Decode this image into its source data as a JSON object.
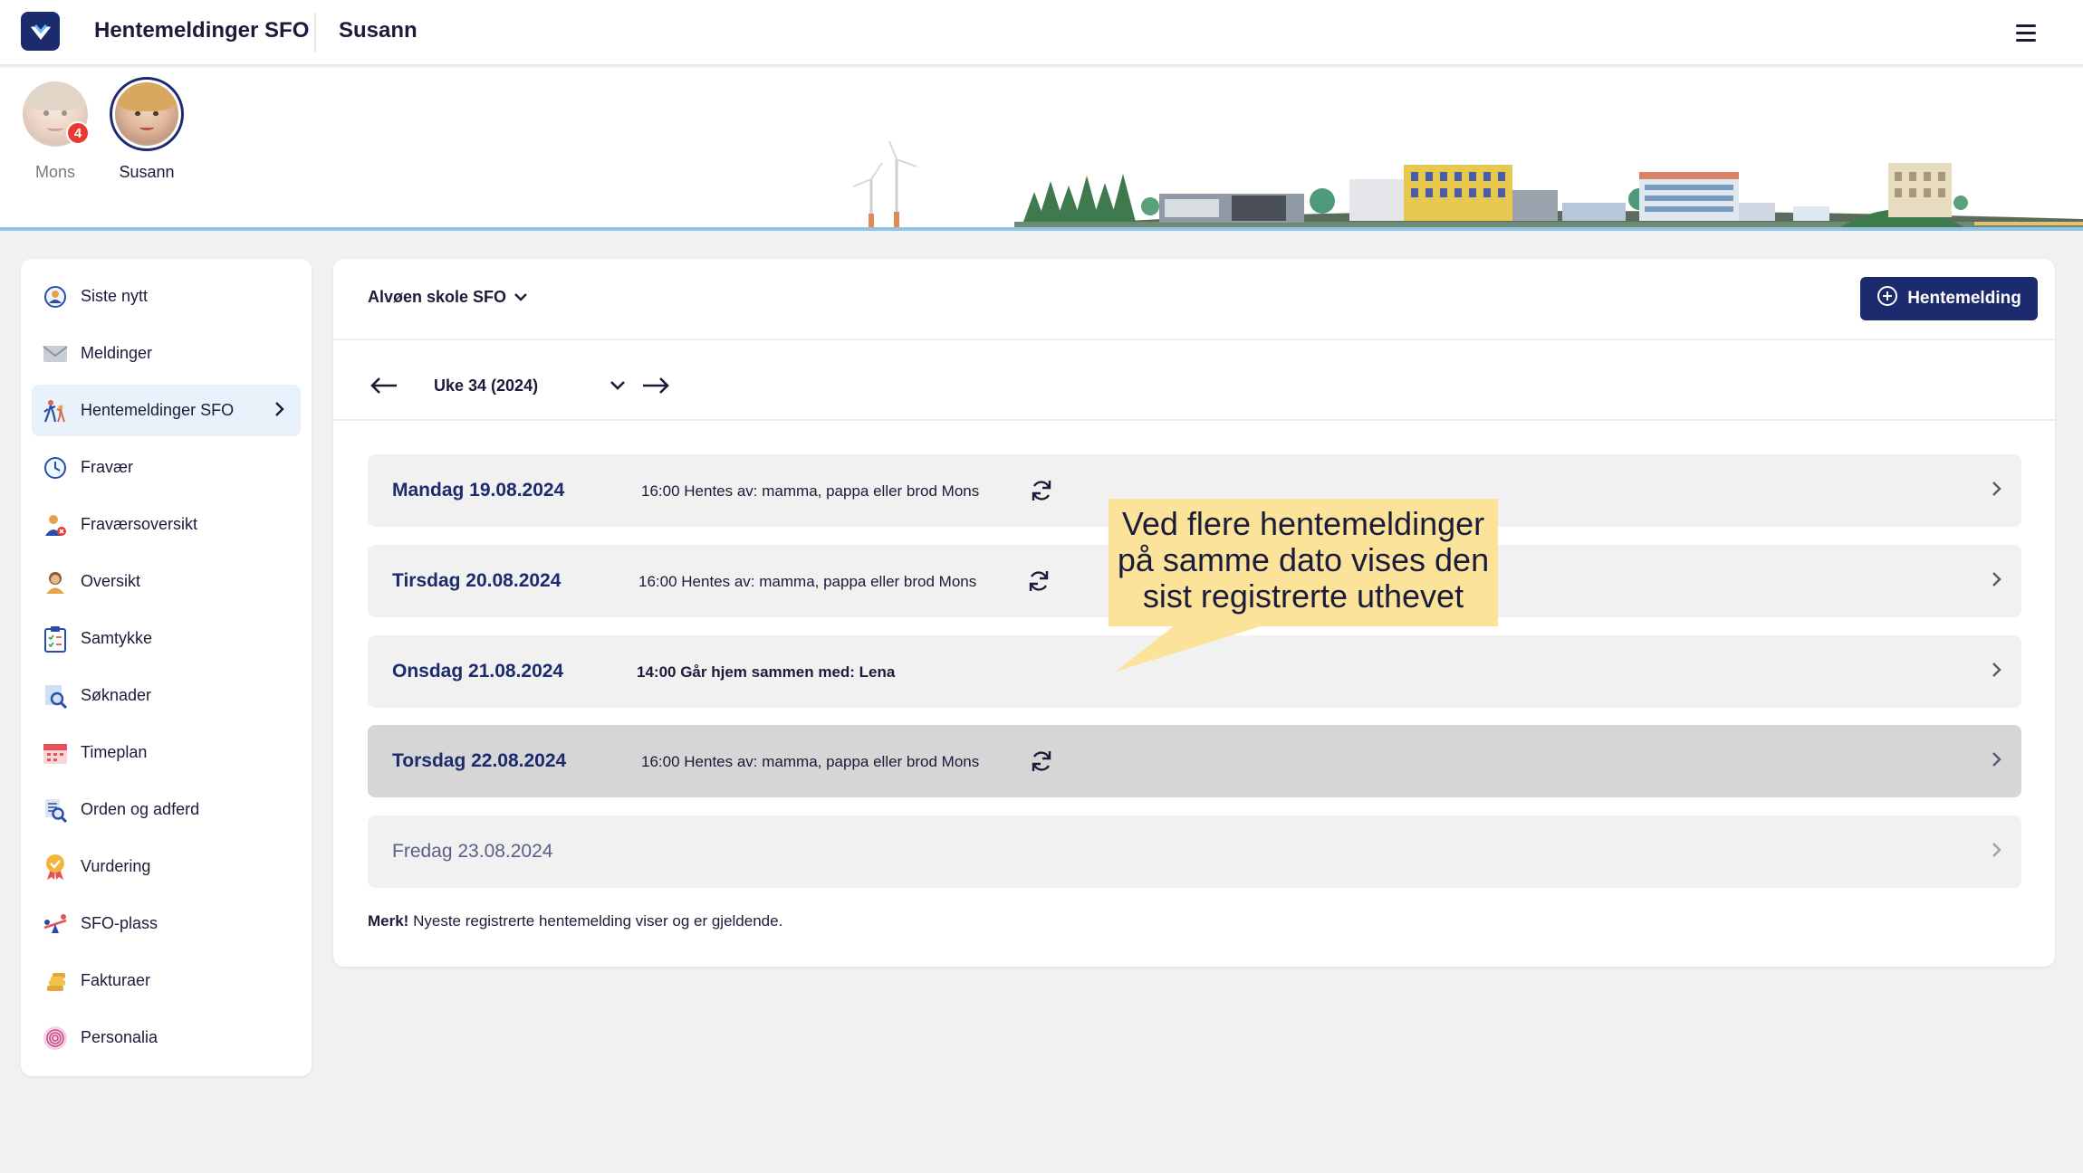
{
  "topbar": {
    "app_title": "Hentemeldinger SFO",
    "user_title": "Susann",
    "menu_icon": "hamburger-icon"
  },
  "children": [
    {
      "name": "Mons",
      "badge": "4",
      "active": false
    },
    {
      "name": "Susann",
      "badge": "",
      "active": true
    }
  ],
  "sidebar": {
    "items": [
      {
        "label": "Siste nytt",
        "icon": "news-icon"
      },
      {
        "label": "Meldinger",
        "icon": "envelope-icon"
      },
      {
        "label": "Hentemeldinger SFO",
        "icon": "pickup-icon",
        "active": true
      },
      {
        "label": "Fravær",
        "icon": "clock-icon"
      },
      {
        "label": "Fraværsoversikt",
        "icon": "absence-person-icon"
      },
      {
        "label": "Oversikt",
        "icon": "person-icon"
      },
      {
        "label": "Samtykke",
        "icon": "clipboard-icon"
      },
      {
        "label": "Søknader",
        "icon": "search-document-icon"
      },
      {
        "label": "Timeplan",
        "icon": "calendar-icon"
      },
      {
        "label": "Orden og adferd",
        "icon": "magnifier-document-icon"
      },
      {
        "label": "Vurdering",
        "icon": "medal-icon"
      },
      {
        "label": "SFO-plass",
        "icon": "seesaw-icon"
      },
      {
        "label": "Fakturaer",
        "icon": "coins-icon"
      },
      {
        "label": "Personalia",
        "icon": "fingerprint-icon"
      }
    ]
  },
  "main": {
    "school": "Alvøen skole SFO",
    "new_button": "Hentemelding",
    "week_label": "Uke 34 (2024)",
    "days": [
      {
        "date": "Mandag 19.08.2024",
        "info": "16:00 Hentes av: mamma, pappa eller brod Mons",
        "sync": true,
        "bold": false,
        "highlight": false,
        "muted": false
      },
      {
        "date": "Tirsdag 20.08.2024",
        "info": "16:00 Hentes av: mamma, pappa eller brod Mons",
        "sync": true,
        "bold": false,
        "highlight": false,
        "muted": false
      },
      {
        "date": "Onsdag 21.08.2024",
        "info": "14:00 Går hjem sammen med: Lena",
        "sync": false,
        "bold": true,
        "highlight": false,
        "muted": false
      },
      {
        "date": "Torsdag 22.08.2024",
        "info": "16:00 Hentes av: mamma, pappa eller brod Mons",
        "sync": true,
        "bold": false,
        "highlight": true,
        "muted": false
      },
      {
        "date": "Fredag 23.08.2024",
        "info": "",
        "sync": false,
        "bold": false,
        "highlight": false,
        "muted": true
      }
    ],
    "note_strong": "Merk!",
    "note_text": " Nyeste registrerte hentemelding viser og er gjeldende."
  },
  "callout": {
    "lines": [
      "Ved flere hentemeldinger",
      "på samme dato vises den",
      "sist registrerte uthevet"
    ]
  },
  "colors": {
    "primary": "#1c2b6e",
    "callout": "#fbe39a",
    "badge": "#e63b2e",
    "row_bg": "#f1f1f1",
    "row_highlight": "#d6d6d6"
  }
}
